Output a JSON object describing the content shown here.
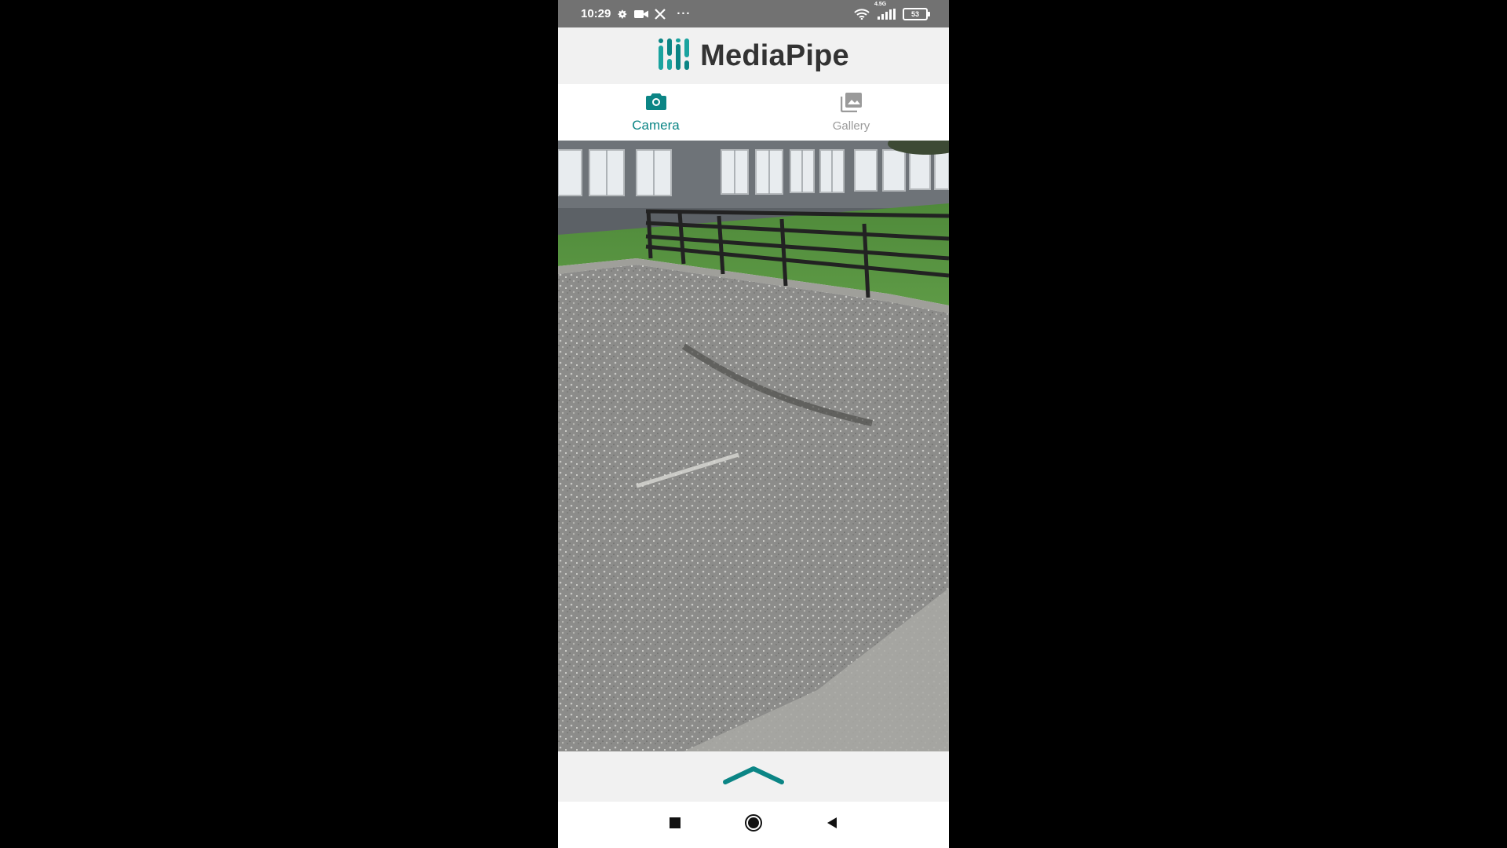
{
  "status_bar": {
    "time": "10:29",
    "left_icons": [
      "gear-icon",
      "video-camera-icon",
      "x-logo-icon",
      "more-icon"
    ],
    "more": "···",
    "network": "4.5G",
    "battery": "53"
  },
  "app": {
    "title": "MediaPipe"
  },
  "tabs": [
    {
      "label": "Camera",
      "icon": "camera-icon",
      "active": true
    },
    {
      "label": "Gallery",
      "icon": "gallery-icon",
      "active": false
    }
  ],
  "colors": {
    "accent": "#0b8585",
    "status_bar": "#727272",
    "background": "#000000"
  },
  "bottom_sheet": {
    "icon": "chevron-up-icon"
  },
  "nav_bar": {
    "icons": [
      "recents-square-icon",
      "home-circle-icon",
      "back-triangle-icon"
    ]
  }
}
